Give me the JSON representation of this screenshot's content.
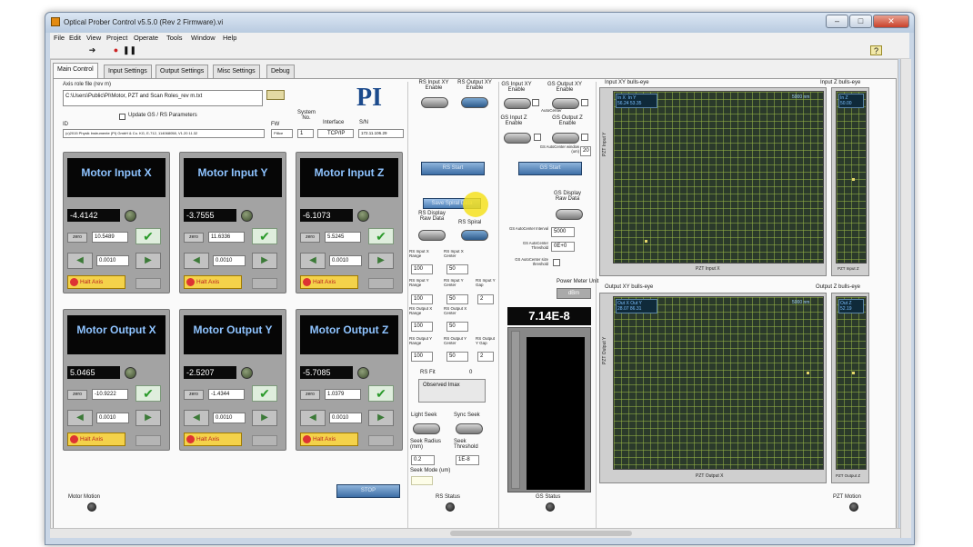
{
  "window": {
    "title": "Optical Prober Control v5.5.0 (Rev 2 Firmware).vi"
  },
  "menu": [
    "File",
    "Edit",
    "View",
    "Project",
    "Operate",
    "Tools",
    "Window",
    "Help"
  ],
  "tabs": [
    "Main Control",
    "Input Settings",
    "Output Settings",
    "Misc Settings",
    "Debug"
  ],
  "axis_file": {
    "label": "Axis role file  (rev m)",
    "value": "C:\\Users\\Public\\PI\\Motor, PZT and Scan Roles_rev m.txt",
    "update_label": "Update GS / RS Parameters"
  },
  "id_row": {
    "id_label": "ID",
    "id_value": "(c)2015 Physik Instrumente (PI) GmbH & Co. KG, E-712, 114068058, V1.20 11.32",
    "fw_label": "FW",
    "fw_value": "PI8ce",
    "sysno_label": "System No.",
    "sysno_value": "1",
    "iface_label": "Interface",
    "iface_value": "TCP/IP",
    "sn_label": "S/N",
    "sn_value": "172.11.106.29"
  },
  "logo": "PI",
  "motors": [
    {
      "title": "Motor Input X",
      "value": "-4.4142",
      "setpoint": "10.5489",
      "step": "0.0010"
    },
    {
      "title": "Motor Input Y",
      "value": "-3.7555",
      "setpoint": "11.6336",
      "step": "0.0010"
    },
    {
      "title": "Motor Input Z",
      "value": "-6.1073",
      "setpoint": "5.5245",
      "step": "0.0010"
    },
    {
      "title": "Motor Output X",
      "value": "5.0465",
      "setpoint": "-10.9222",
      "step": "0.0010"
    },
    {
      "title": "Motor Output Y",
      "value": "-2.5207",
      "setpoint": "-1.4344",
      "step": "0.0010"
    },
    {
      "title": "Motor Output Z",
      "value": "-5.7085",
      "setpoint": "1.0379",
      "step": "0.0010"
    }
  ],
  "motor_labels": {
    "zero": "zero",
    "halt": "Halt Axis"
  },
  "stop_label": "STOP",
  "motor_motion": "Motor Motion",
  "rs": {
    "input_xy": "RS Input XY Enable",
    "output_xy": "RS Output XY Enable",
    "start": "RS Start",
    "save_btn": "Save Spiral Data",
    "display_raw": "RS Display Raw Data",
    "spiral": "RS Spiral",
    "in_x_range": "RS Input X Range",
    "in_x_range_v": "100",
    "in_x_center": "RS Input X Center",
    "in_x_center_v": "50",
    "in_y_range": "RS Input Y Range",
    "in_y_range_v": "100",
    "in_y_center": "RS Input Y Center",
    "in_y_center_v": "50",
    "in_y_gap": "RS Input Y Gap",
    "in_y_gap_v": "2",
    "out_x_range": "RS Output X Range",
    "out_x_range_v": "100",
    "out_x_center": "RS Output X Center",
    "out_x_center_v": "50",
    "out_y_range": "RS Output Y Range",
    "out_y_range_v": "100",
    "out_y_center": "RS Output Y Center",
    "out_y_center_v": "50",
    "out_y_gap": "RS Output Y Gap",
    "out_y_gap_v": "2",
    "fit": "RS Fit",
    "fit_num": "0",
    "observed": "Observed Imax",
    "light_seek": "Light Seek",
    "sync_seek": "Sync Seek",
    "seek_radius": "Seek Radius (mm)",
    "seek_radius_v": "0.2",
    "seek_threshold": "Seek Threshold",
    "seek_threshold_v": "1E-8",
    "seek_mode": "Seek Mode (um)",
    "status": "RS Status"
  },
  "gs": {
    "input_xy": "GS Input XY Enable",
    "output_xy": "GS Output XY Enable",
    "auto_center": "AutoCenter",
    "input_z": "GS Input Z Enable",
    "output_z": "GS Output Z Enable",
    "ac_window": "GS AutoCenter window (um)",
    "ac_window_v": "20",
    "start": "GS Start",
    "display_raw": "GS Display Raw Data",
    "ac_interval": "GS AutoCenter Interval",
    "ac_interval_v": "5000",
    "ac_threshold": "GS AutoCenter Threshold",
    "ac_threshold_v": "0E+0",
    "ac_size": "GS AutoCenter size threshold",
    "status": "GS Status"
  },
  "power_meter": {
    "label": "Power Meter Unit",
    "unit": "dBm",
    "value": "7.14E-8"
  },
  "plots": {
    "input_xy": "Input XY bulls-eye",
    "input_z": "Input Z bulls-eye",
    "output_xy": "Output XY bulls-eye",
    "output_z": "Output Z bulls-eye",
    "in_legend_1": "In X",
    "in_legend_1v": "56.24",
    "in_legend_2": "In Y",
    "in_legend_2v": "53.35",
    "in_z_legend": "In Z",
    "in_z_legend_v": "50.00",
    "out_legend_1": "Out X",
    "out_legend_1v": "28.07",
    "out_legend_2": "Out Y",
    "out_legend_2v": "86.31",
    "out_z_legend": "Out Z",
    "out_z_legend_v": "52.19",
    "in_range": "5000 nm",
    "out_range": "5000 nm",
    "in_yaxis": "PZT Input Y",
    "in_xaxis": "PZT Input X",
    "out_yaxis": "PZT Output Y",
    "out_xaxis": "PZT Output X",
    "in_z_axis": "PZT Input Z",
    "out_z_axis": "PZT Output Z",
    "pzt_motion": "PZT Motion"
  }
}
